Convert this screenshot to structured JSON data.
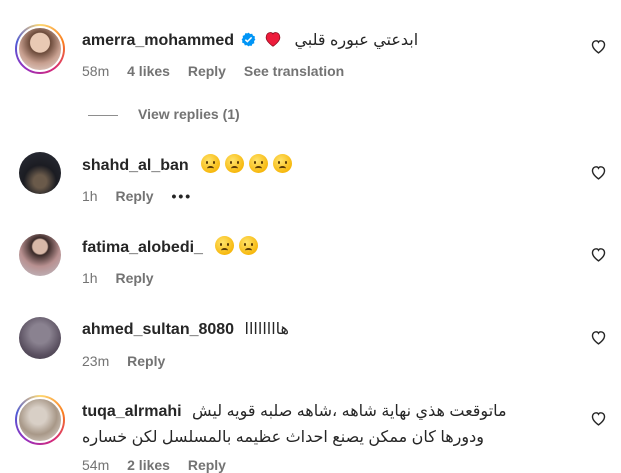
{
  "comments": [
    {
      "username": "amerra_mohammed",
      "verified": true,
      "text": "ابدعتي عبوره قلبي",
      "time": "58m",
      "likes": "4 likes",
      "reply": "Reply",
      "translate": "See translation",
      "view_replies": "View replies (1)"
    },
    {
      "username": "shahd_al_ban",
      "text": "",
      "emoji_count": 4,
      "time": "1h",
      "reply": "Reply",
      "more": "•••"
    },
    {
      "username": "fatima_alobedi_",
      "text": "",
      "emoji_count": 2,
      "time": "1h",
      "reply": "Reply"
    },
    {
      "username": "ahmed_sultan_8080",
      "text": "هاااااااا",
      "time": "23m",
      "reply": "Reply"
    },
    {
      "username": "tuqa_alrmahi",
      "text_line1": "ماتوقعت هذي نهاية شاهه ،شاهه صلبه قويه ليش",
      "text_line2": "ودورها كان ممكن يصنع احداث عظيمه بالمسلسل لكن خساره",
      "time": "54m",
      "likes": "2 likes",
      "reply": "Reply"
    }
  ],
  "colors": {
    "text": "#262626",
    "muted": "#737373",
    "verified": "#0095f6",
    "heart_red": "#ed1c3b"
  },
  "icons": {
    "like": "heart-outline-icon",
    "verified": "verified-badge-icon",
    "sad": "sad-face-emoji"
  }
}
